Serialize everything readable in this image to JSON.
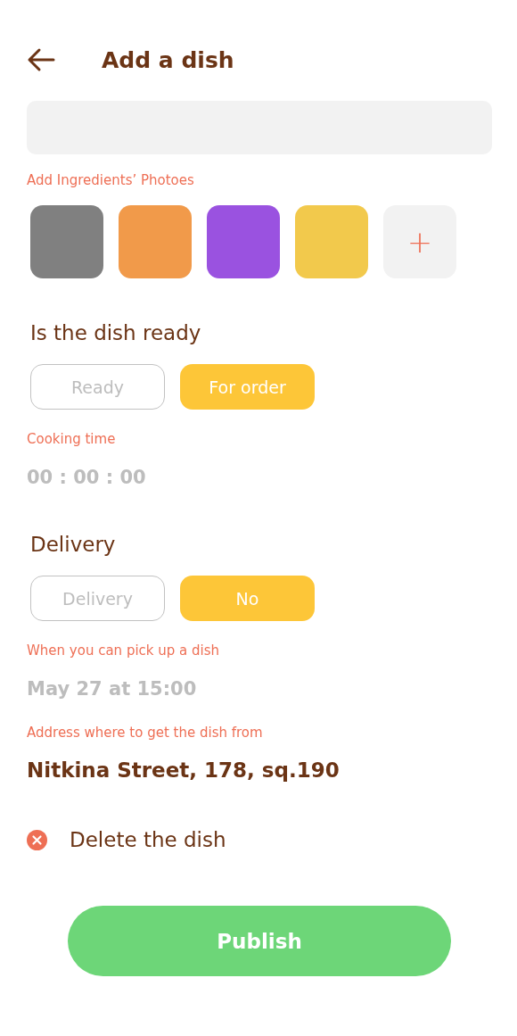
{
  "header": {
    "title": "Add a dish"
  },
  "photos": {
    "label": "Add Ingredients’ Photoes",
    "add_symbol": "+",
    "items": [
      {
        "color": "#808080"
      },
      {
        "color": "#f19a4a"
      },
      {
        "color": "#9a52e0"
      },
      {
        "color": "#f2c94c"
      }
    ]
  },
  "readiness": {
    "heading": "Is the dish ready",
    "options": [
      {
        "label": "Ready",
        "selected": false
      },
      {
        "label": "For order",
        "selected": true
      }
    ]
  },
  "cooking_time": {
    "label": "Cooking time",
    "value": "00 : 00 : 00"
  },
  "delivery": {
    "heading": "Delivery",
    "options": [
      {
        "label": "Delivery",
        "selected": false
      },
      {
        "label": "No",
        "selected": true
      }
    ]
  },
  "pickup_time": {
    "label": "When you can pick up a dish",
    "value": "May 27 at 15:00"
  },
  "address": {
    "label": "Address where to get the dish from",
    "value": "Nitkina Street, 178, sq.190"
  },
  "delete": {
    "label": "Delete the dish"
  },
  "publish": {
    "label": "Publish"
  }
}
